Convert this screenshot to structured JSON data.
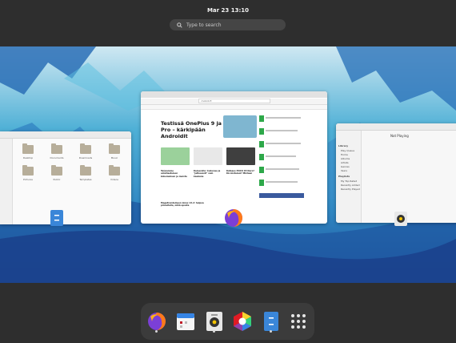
{
  "topbar": {
    "clock": "Mar 23  13:10"
  },
  "search": {
    "placeholder": "Type to search"
  },
  "windows": {
    "files": {
      "folders": [
        "Desktop",
        "Documents",
        "Downloads",
        "Music",
        "Pictures",
        "Public",
        "Templates",
        "Videos"
      ]
    },
    "browser": {
      "site": "mobiili.fi",
      "headline": "Testissä OnePlus 9 ja 9 Pro – kärkipään Androidit",
      "articles": [
        "Tarjoamme ainutlaatuisen kokemuksen ja muista",
        "Kameralla: Codeswe ja \"jatkuvasti\" vain kaukana",
        "Katsaus POCO X3 Nero? Kä mistamoi? Mistaan",
        "Megatrendeineen Linux 13.2: helpoa pinnoitella, mikä eposta"
      ]
    },
    "music": {
      "header": "Not Playing",
      "library_items": [
        "Library",
        "Play Queue",
        "Home",
        "Albums",
        "Artists",
        "Genres",
        "Years",
        "Playlists",
        "My Top Rated",
        "Recently Added",
        "Recently Played"
      ]
    }
  },
  "dock": {
    "apps": [
      {
        "name": "Firefox",
        "running": true
      },
      {
        "name": "Calendar",
        "running": false
      },
      {
        "name": "Rhythmbox",
        "running": true
      },
      {
        "name": "Software",
        "running": false
      },
      {
        "name": "Files",
        "running": true
      },
      {
        "name": "Show Applications",
        "running": false
      }
    ]
  },
  "colors": {
    "accent": "#3584e4",
    "panel": "#2e2e2e",
    "dock": "#3b3b3b",
    "wallpaper": "#4aa3c9"
  }
}
